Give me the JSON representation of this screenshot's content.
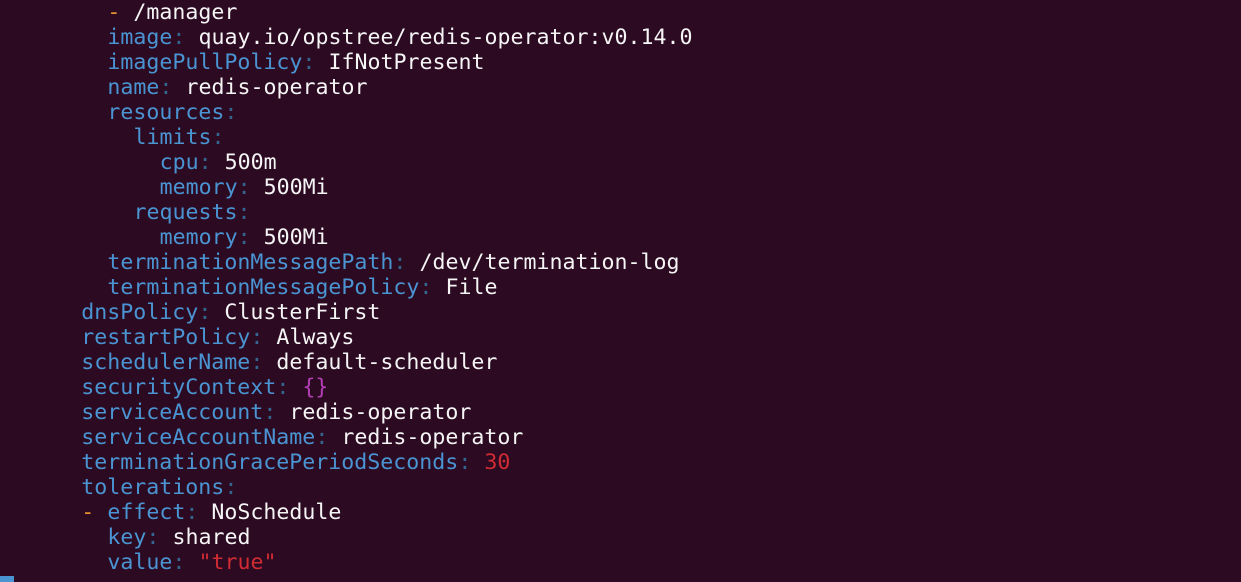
{
  "lines": [
    {
      "indent": 4,
      "dash": "- ",
      "value": "/manager"
    },
    {
      "indent": 4,
      "key": "image",
      "value": "quay.io/opstree/redis-operator:v0.14.0"
    },
    {
      "indent": 4,
      "key": "imagePullPolicy",
      "value": "IfNotPresent"
    },
    {
      "indent": 4,
      "key": "name",
      "value": "redis-operator"
    },
    {
      "indent": 4,
      "key": "resources"
    },
    {
      "indent": 5,
      "key": "limits"
    },
    {
      "indent": 6,
      "key": "cpu",
      "value": "500m"
    },
    {
      "indent": 6,
      "key": "memory",
      "value": "500Mi"
    },
    {
      "indent": 5,
      "key": "requests"
    },
    {
      "indent": 6,
      "key": "memory",
      "value": "500Mi"
    },
    {
      "indent": 4,
      "key": "terminationMessagePath",
      "value": "/dev/termination-log"
    },
    {
      "indent": 4,
      "key": "terminationMessagePolicy",
      "value": "File"
    },
    {
      "indent": 3,
      "key": "dnsPolicy",
      "value": "ClusterFirst"
    },
    {
      "indent": 3,
      "key": "restartPolicy",
      "value": "Always"
    },
    {
      "indent": 3,
      "key": "schedulerName",
      "value": "default-scheduler"
    },
    {
      "indent": 3,
      "key": "securityContext",
      "value": "{}",
      "vtype": "braces"
    },
    {
      "indent": 3,
      "key": "serviceAccount",
      "value": "redis-operator"
    },
    {
      "indent": 3,
      "key": "serviceAccountName",
      "value": "redis-operator"
    },
    {
      "indent": 3,
      "key": "terminationGracePeriodSeconds",
      "value": "30",
      "vtype": "num"
    },
    {
      "indent": 3,
      "key": "tolerations"
    },
    {
      "indent": 3,
      "dash": "- ",
      "key": "effect",
      "value": "NoSchedule"
    },
    {
      "indent": 4,
      "key": "key",
      "value": "shared"
    },
    {
      "indent": 4,
      "key": "value",
      "value": "\"true\"",
      "vtype": "str"
    }
  ],
  "colors": {
    "background": "#2c0a22",
    "key": "#4a94d2",
    "colon": "#33658f",
    "dash": "#e88f2e",
    "value": "#f5f5f5",
    "number": "#d12b33",
    "string": "#d12b33",
    "braces": "#b43fb5"
  }
}
